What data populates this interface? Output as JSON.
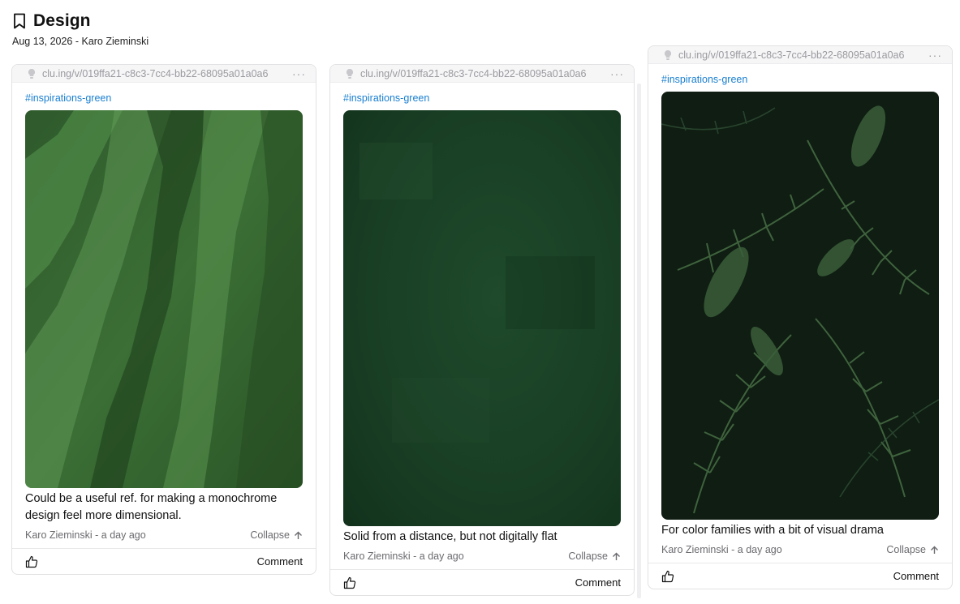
{
  "header": {
    "title": "Design",
    "meta": "Aug 13, 2026 - Karo Zieminski"
  },
  "icons": {
    "title": "bookmark-icon",
    "source": "lightbulb-icon",
    "menu": "more-horizontal-icon",
    "collapse": "arrow-up-icon",
    "like": "thumbs-up-icon"
  },
  "colors": {
    "tag": "#1a7fd0",
    "muted": "#6b6b70",
    "card_border": "#e2e2e4",
    "card_top": "#f6f6f7"
  },
  "cards": [
    {
      "url": "clu.ing/v/019ffa21-c8c3-7cc4-bb22-68095a01a0a6",
      "menu": "···",
      "tag": "#inspirations-green",
      "image": "green textured rolled paint texture",
      "caption": "Could be a useful ref. for making a monochrome design feel more dimensional.",
      "author": "Karo Zieminski - a day ago",
      "collapse": "Collapse",
      "comment": "Comment"
    },
    {
      "url": "clu.ing/v/019ffa21-c8c3-7cc4-bb22-68095a01a0a6",
      "menu": "···",
      "tag": "#inspirations-green",
      "image": "solid dark green textured surface",
      "caption": "Solid from a distance, but not digitally flat",
      "author": "Karo Zieminski - a day ago",
      "collapse": "Collapse",
      "comment": "Comment"
    },
    {
      "url": "clu.ing/v/019ffa21-c8c3-7cc4-bb22-68095a01a0a6",
      "menu": "···",
      "tag": "#inspirations-green",
      "image": "dark green fern foliage",
      "caption": "For color families with a bit of visual drama",
      "author": "Karo Zieminski - a day ago",
      "collapse": "Collapse",
      "comment": "Comment"
    }
  ]
}
